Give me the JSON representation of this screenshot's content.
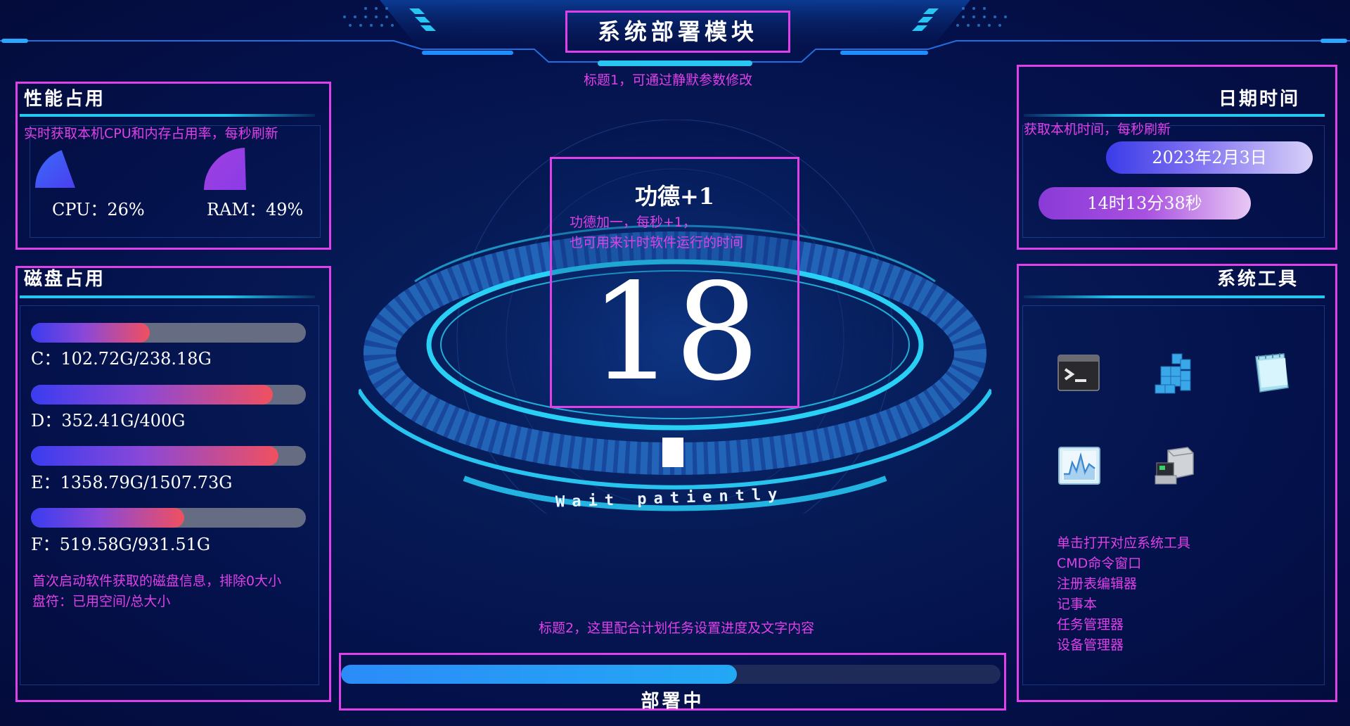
{
  "header": {
    "title": "系统部署模块",
    "subtitle_note": "标题1，可通过静默参数修改"
  },
  "performance": {
    "title": "性能占用",
    "note": "实时获取本机CPU和内存占用率，每秒刷新",
    "cpu_label": "CPU：26%",
    "cpu_percent": 26,
    "ram_label": "RAM：49%",
    "ram_percent": 49
  },
  "disk": {
    "title": "磁盘占用",
    "drives": [
      {
        "label": "C：102.72G/238.18G",
        "fraction": 0.431
      },
      {
        "label": "D：352.41G/400G",
        "fraction": 0.881
      },
      {
        "label": "E：1358.79G/1507.73G",
        "fraction": 0.901
      },
      {
        "label": "F：519.58G/931.51G",
        "fraction": 0.558
      }
    ],
    "note_line1": "首次启动软件获取的磁盘信息，排除0大小",
    "note_line2": "盘符：已用空间/总大小"
  },
  "center": {
    "merit_title": "功德+1",
    "merit_note_line1": "功德加一，每秒+1，",
    "merit_note_line2": "也可用来计时软件运行的时间",
    "counter": "18",
    "wait_text": "Wait patiently"
  },
  "progress": {
    "note": "标题2，这里配合计划任务设置进度及文字内容",
    "label": "部署中",
    "fraction": 0.6
  },
  "datetime": {
    "title": "日期时间",
    "note": "获取本机时间，每秒刷新",
    "date": "2023年2月3日",
    "time": "14时13分38秒"
  },
  "tools": {
    "title": "系统工具",
    "icons": [
      "cmd-icon",
      "registry-editor-icon",
      "notepad-icon",
      "task-manager-icon",
      "device-manager-icon"
    ],
    "note_lines": [
      "单击打开对应系统工具",
      "CMD命令窗口",
      "注册表编辑器",
      "记事本",
      "任务管理器",
      "设备管理器"
    ]
  },
  "colors": {
    "annotation": "#e040e8",
    "accent_cyan": "#22c8f0",
    "background": "#061a55"
  }
}
